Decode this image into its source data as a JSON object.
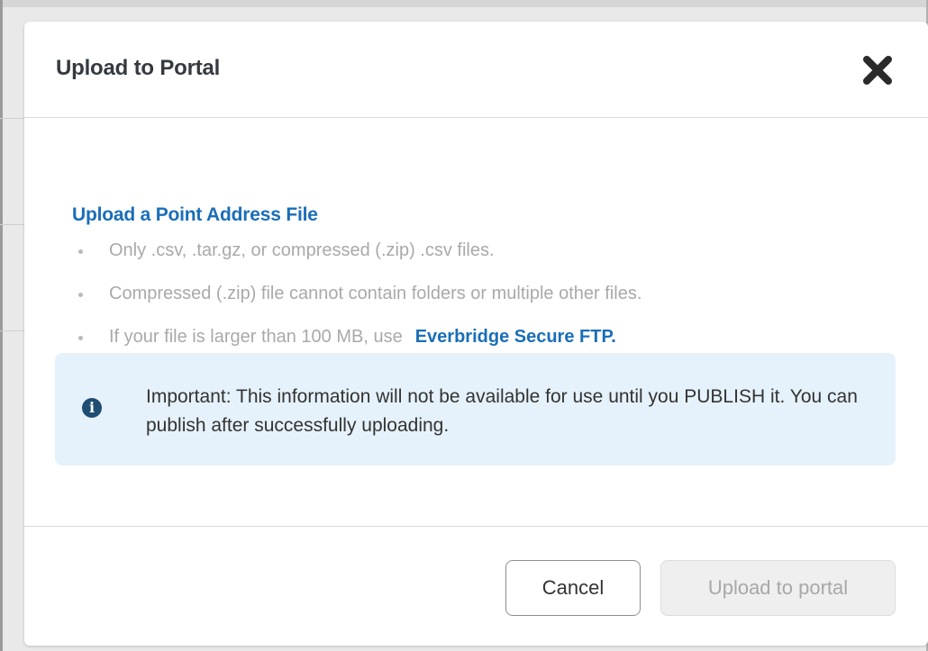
{
  "modal": {
    "title": "Upload to Portal",
    "close_icon": "close-x-icon"
  },
  "body": {
    "section_title": "Upload a Point Address File",
    "bullets": [
      {
        "text": "Only .csv, .tar.gz, or compressed (.zip) .csv files."
      },
      {
        "text": "Compressed (.zip) file cannot contain folders or multiple other files."
      },
      {
        "text": "If your file is larger than 100 MB, use",
        "link": "Everbridge Secure FTP."
      }
    ],
    "info": {
      "icon": "info-circle-icon",
      "text": "Important: This information will not be available for use until you PUBLISH it. You can publish after successfully uploading."
    }
  },
  "footer": {
    "cancel_label": "Cancel",
    "upload_label": "Upload to portal",
    "upload_enabled": false
  },
  "colors": {
    "accent": "#1a6eb8",
    "info_bg": "#e6f2fb",
    "info_icon": "#1f4c72",
    "muted_text": "#a9a9a9"
  }
}
